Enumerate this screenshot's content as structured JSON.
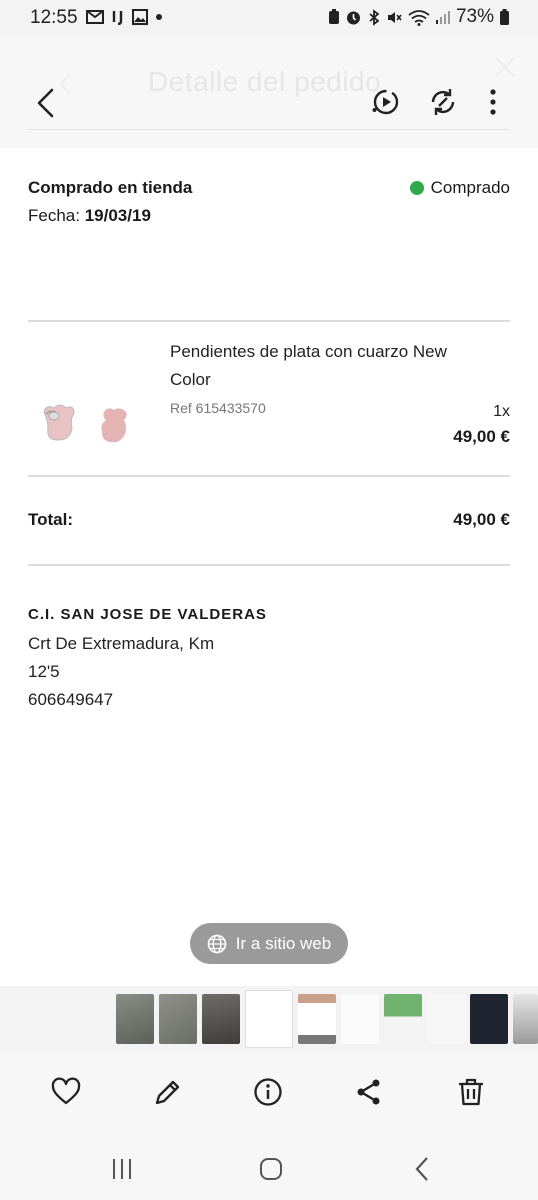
{
  "status_bar": {
    "time": "12:55",
    "battery": "73%",
    "left_icons": [
      "gmail-icon",
      "ij-icon",
      "gallery-icon",
      "dot-icon"
    ],
    "right_icons": [
      "battery-saver-icon",
      "alarm-icon",
      "bluetooth-icon",
      "mute-icon",
      "wifi-icon",
      "signal-icon",
      "battery-icon"
    ]
  },
  "header": {
    "title": "Detalle del pedido"
  },
  "order": {
    "purchase_type": "Comprado en tienda",
    "date_label": "Fecha:",
    "date_value": "19/03/19",
    "status": "Comprado",
    "status_color": "#2eaa4a"
  },
  "product": {
    "name": "Pendientes de plata con cuarzo New Color",
    "ref": "Ref 615433570",
    "quantity": "1x",
    "price": "49,00 €"
  },
  "total": {
    "label": "Total:",
    "value": "49,00 €"
  },
  "store": {
    "name": "C.I. SAN JOSE DE VALDERAS",
    "address_line1": "Crt De Extremadura, Km",
    "address_line2": "12'5",
    "phone": "606649647"
  },
  "web_button": {
    "label": "Ir a sitio web"
  },
  "toolbar": {
    "items": [
      "heart-icon",
      "edit-icon",
      "info-icon",
      "share-icon",
      "delete-icon"
    ]
  },
  "navbar": {
    "items": [
      "recents-icon",
      "home-icon",
      "back-icon"
    ]
  }
}
